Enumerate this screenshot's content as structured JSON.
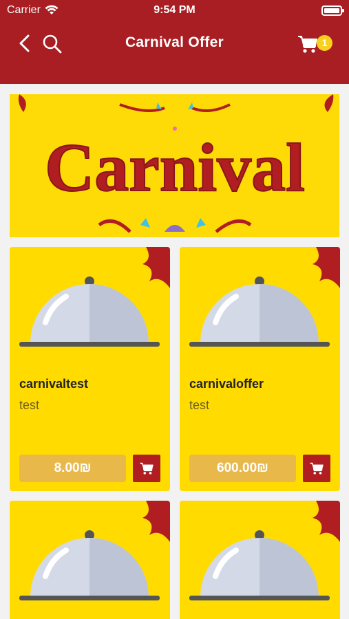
{
  "status_bar": {
    "carrier": "Carrier",
    "time": "9:54 PM"
  },
  "nav": {
    "title": "Carnival Offer",
    "cart_count": "1"
  },
  "banner": {
    "text": "Carnival"
  },
  "products": [
    {
      "name": "carnivaltest",
      "description": "test",
      "price": "8.00₪"
    },
    {
      "name": "carnivaloffer",
      "description": "test",
      "price": "600.00₪"
    },
    {
      "name": "",
      "description": "",
      "price": ""
    },
    {
      "name": "",
      "description": "",
      "price": ""
    }
  ],
  "colors": {
    "header": "#a81e22",
    "card": "#ffdb00",
    "price_bg": "#e8b94a",
    "badge": "#f7d11e",
    "accent": "#b01e22"
  }
}
